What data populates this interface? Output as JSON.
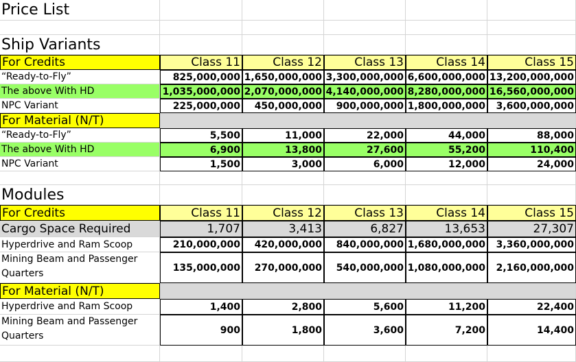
{
  "title": "Price List",
  "classes": [
    "Class 11",
    "Class 12",
    "Class 13",
    "Class 14",
    "Class 15"
  ],
  "ship_variants": {
    "heading": "Ship Variants",
    "credits_label": "For Credits",
    "credits_rows": [
      {
        "label": "“Ready-to-Fly”",
        "values": [
          "825,000,000",
          "1,650,000,000",
          "3,300,000,000",
          "6,600,000,000",
          "13,200,000,000"
        ]
      },
      {
        "label": "The above With HD",
        "values": [
          "1,035,000,000",
          "2,070,000,000",
          "4,140,000,000",
          "8,280,000,000",
          "16,560,000,000"
        ]
      },
      {
        "label": "NPC Variant",
        "values": [
          "225,000,000",
          "450,000,000",
          "900,000,000",
          "1,800,000,000",
          "3,600,000,000"
        ]
      }
    ],
    "material_label": "For Material (N/T)",
    "material_rows": [
      {
        "label": "“Ready-to-Fly”",
        "values": [
          "5,500",
          "11,000",
          "22,000",
          "44,000",
          "88,000"
        ]
      },
      {
        "label": "The above With HD",
        "values": [
          "6,900",
          "13,800",
          "27,600",
          "55,200",
          "110,400"
        ]
      },
      {
        "label": "NPC Variant",
        "values": [
          "1,500",
          "3,000",
          "6,000",
          "12,000",
          "24,000"
        ]
      }
    ]
  },
  "modules": {
    "heading": "Modules",
    "credits_label": "For Credits",
    "cargo_label": "Cargo Space Required",
    "cargo_values": [
      "1,707",
      "3,413",
      "6,827",
      "13,653",
      "27,307"
    ],
    "credits_rows": [
      {
        "label": "Hyperdrive and Ram Scoop",
        "values": [
          "210,000,000",
          "420,000,000",
          "840,000,000",
          "1,680,000,000",
          "3,360,000,000"
        ]
      },
      {
        "label": "Mining Beam and Passenger Quarters",
        "values": [
          "135,000,000",
          "270,000,000",
          "540,000,000",
          "1,080,000,000",
          "2,160,000,000"
        ]
      }
    ],
    "material_label": "For Material (N/T)",
    "material_rows": [
      {
        "label": "Hyperdrive and Ram Scoop",
        "values": [
          "1,400",
          "2,800",
          "5,600",
          "11,200",
          "22,400"
        ]
      },
      {
        "label": "Mining Beam and Passenger Quarters",
        "values": [
          "900",
          "1,800",
          "3,600",
          "7,200",
          "14,400"
        ]
      }
    ]
  },
  "colors": {
    "header_yellow": "#ffff99",
    "section_yellow": "#ffff00",
    "hd_green": "#99ff66",
    "gray": "#d9d9d9"
  }
}
